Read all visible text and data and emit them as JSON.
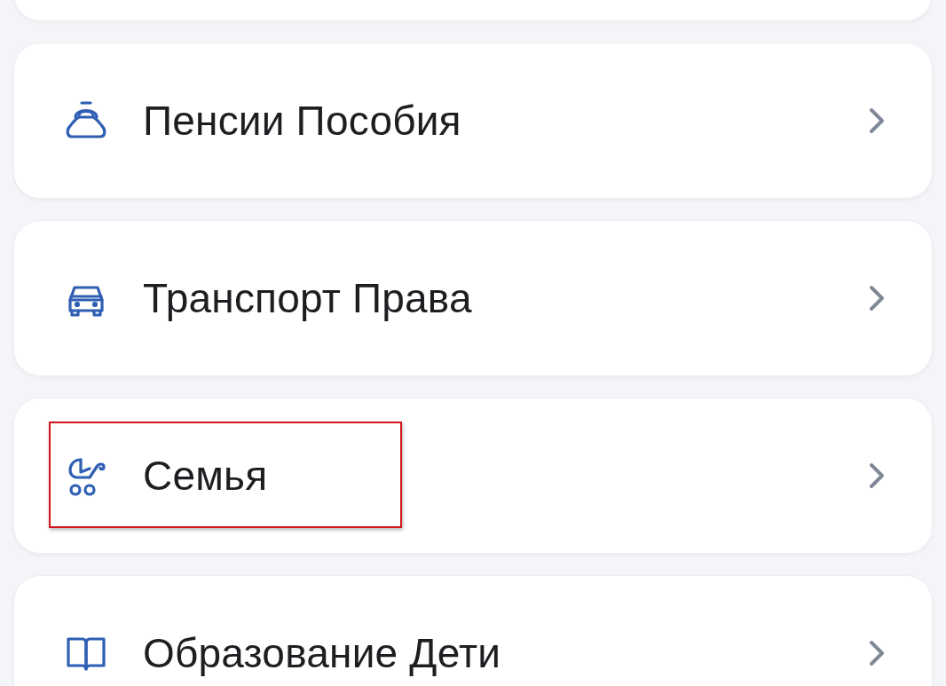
{
  "menu": {
    "items": [
      {
        "kind": "blank",
        "highlighted": false
      },
      {
        "kind": "purse",
        "label": "Пенсии Пособия",
        "highlighted": false
      },
      {
        "kind": "car",
        "label": "Транспорт Права",
        "highlighted": false
      },
      {
        "kind": "stroller",
        "label": "Семья",
        "highlighted": true
      },
      {
        "kind": "book",
        "label": "Образование Дети",
        "highlighted": false
      }
    ]
  }
}
